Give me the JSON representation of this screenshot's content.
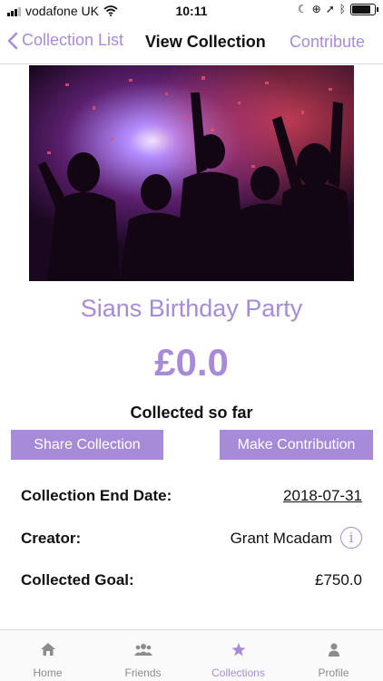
{
  "status_bar": {
    "carrier": "vodafone UK",
    "time": "10:11"
  },
  "nav": {
    "back_label": "Collection List",
    "title": "View Collection",
    "action_label": "Contribute"
  },
  "collection": {
    "title": "Sians Birthday Party",
    "amount": "£0.0",
    "amount_caption": "Collected so far",
    "share_label": "Share Collection",
    "contribute_label": "Make Contribution",
    "end_date_label": "Collection End Date:",
    "end_date": "2018-07-31",
    "creator_label": "Creator:",
    "creator": "Grant Mcadam",
    "goal_label": "Collected Goal:",
    "goal": "£750.0"
  },
  "tabs": [
    {
      "label": "Home",
      "icon": "home-icon"
    },
    {
      "label": "Friends",
      "icon": "friends-icon"
    },
    {
      "label": "Collections",
      "icon": "star-icon",
      "active": true
    },
    {
      "label": "Profile",
      "icon": "person-icon"
    }
  ],
  "colors": {
    "accent": "#a78bd9",
    "text": "#111111",
    "inactive": "#8c8c8c"
  }
}
